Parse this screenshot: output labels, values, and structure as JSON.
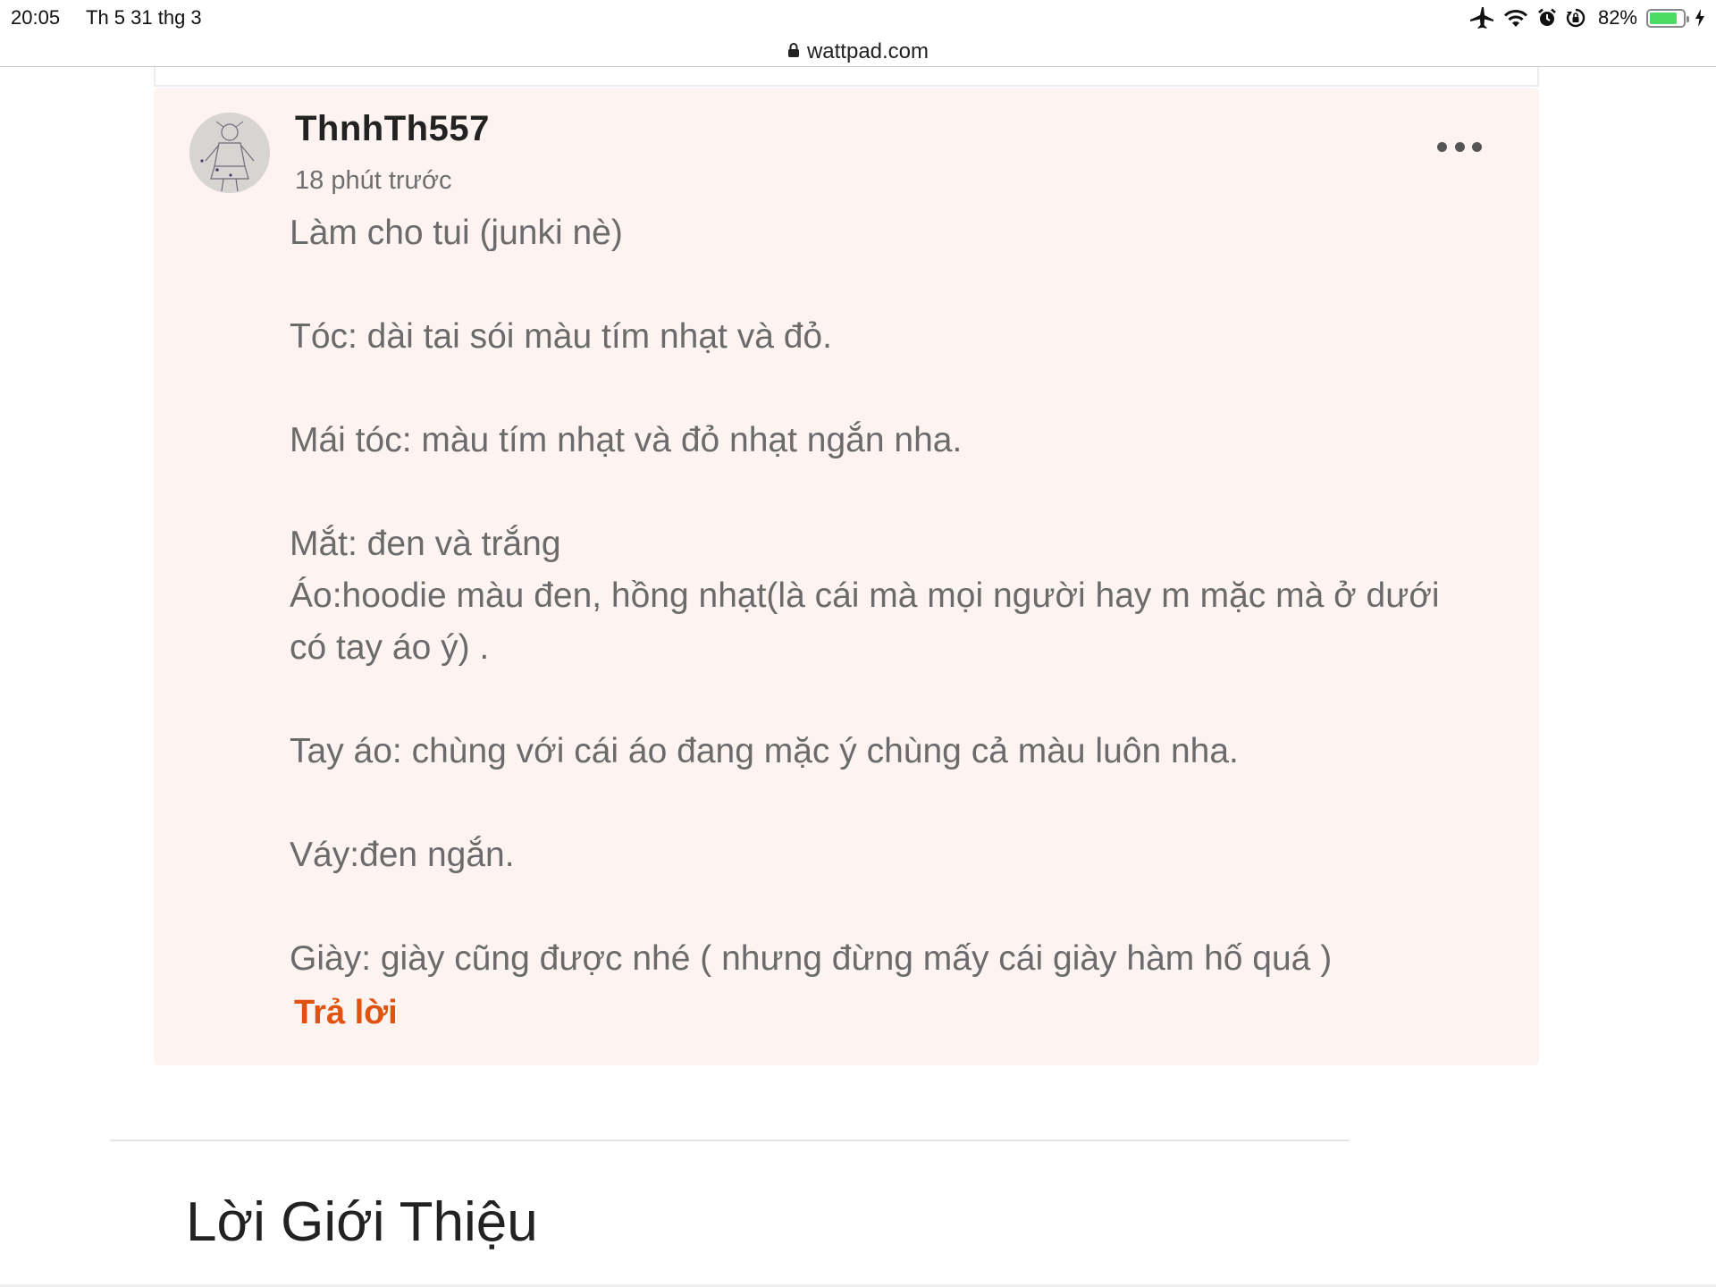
{
  "status_bar": {
    "time": "20:05",
    "date": "Th 5 31 thg 3",
    "battery_percent": "82%",
    "battery_level": 0.82,
    "icons": [
      "airplane-icon",
      "wifi-icon",
      "alarm-icon",
      "orientation-lock-icon",
      "battery-icon",
      "charging-icon"
    ]
  },
  "browser": {
    "url": "wattpad.com"
  },
  "comment": {
    "username": "ThnhTh557",
    "timestamp": "18 phút trước",
    "lines": [
      "Làm cho tui (junki nè)",
      "",
      "Tóc: dài tai sói màu tím nhạt và đỏ.",
      "",
      "Mái tóc: màu tím nhạt và đỏ nhạt ngắn nha.",
      "",
      "Mắt: đen và trắng",
      "Áo:hoodie màu đen, hồng nhạt(là cái mà mọi người hay m mặc mà ở dưới",
      "có tay áo ý) .",
      "",
      "Tay áo: chùng với cái áo đang mặc ý chùng cả màu luôn nha.",
      "",
      "Váy:đen ngắn.",
      "",
      "Giày: giày cũng được nhé ( nhưng đừng mấy cái giày  hàm hố quá )"
    ],
    "reply_label": "Trả lời"
  },
  "section": {
    "title": "Lời Giới Thiệu"
  },
  "colors": {
    "accent": "#e0530f",
    "card_background": "#fdf3f0",
    "battery_green": "#4cd964"
  }
}
